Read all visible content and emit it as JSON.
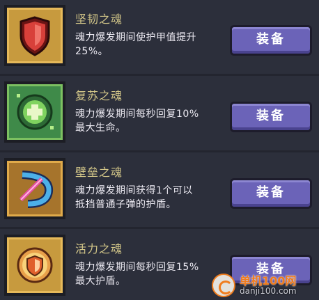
{
  "items": [
    {
      "name": "坚韧之魂",
      "desc_line1": "魂力爆发期间使护甲值提升",
      "desc_line2": "25%。",
      "button_label": "装备",
      "icon": "red-shield-icon"
    },
    {
      "name": "复苏之魂",
      "desc_line1": "魂力爆发期间每秒回复10%",
      "desc_line2": "最大生命。",
      "button_label": "装备",
      "icon": "green-heal-orb-icon"
    },
    {
      "name": "壁垒之魂",
      "desc_line1": "魂力爆发期间获得1个可以",
      "desc_line2": "抵挡普通子弹的护盾。",
      "button_label": "装备",
      "icon": "blue-barrier-bow-icon"
    },
    {
      "name": "活力之魂",
      "desc_line1": "魂力爆发期间每秒回复15%",
      "desc_line2": "最大护盾。",
      "button_label": "装备",
      "icon": "gold-shield-orb-icon"
    }
  ],
  "watermark": {
    "title": "单机100网",
    "url": "danji100.com"
  },
  "colors": {
    "background": "#2c2f3b",
    "name_text": "#d6c98a",
    "button": "#6b63b8"
  }
}
